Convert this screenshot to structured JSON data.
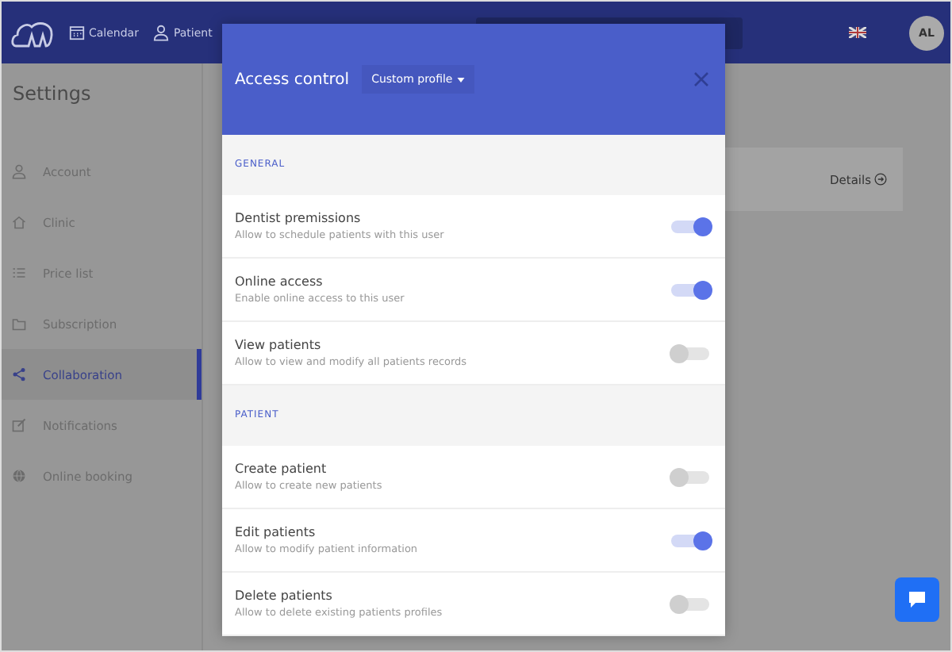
{
  "nav": {
    "items": [
      {
        "label": "Calendar",
        "kind": "calendar"
      },
      {
        "label": "Patient",
        "kind": "user"
      }
    ],
    "avatar": "AL"
  },
  "sidebar": {
    "title": "Settings",
    "items": [
      {
        "label": "Account",
        "kind": "user",
        "selected": false
      },
      {
        "label": "Clinic",
        "kind": "home",
        "selected": false
      },
      {
        "label": "Price list",
        "kind": "list",
        "selected": false
      },
      {
        "label": "Subscription",
        "kind": "folder",
        "selected": false
      },
      {
        "label": "Collaboration",
        "kind": "share",
        "selected": true
      },
      {
        "label": "Notifications",
        "kind": "edit",
        "selected": false
      },
      {
        "label": "Online booking",
        "kind": "globe",
        "selected": false
      }
    ]
  },
  "content": {
    "details_link": "Details"
  },
  "modal": {
    "title": "Access control",
    "profile": "Custom profile",
    "sections": [
      {
        "title": "GENERAL",
        "permissions": [
          {
            "name": "Dentist premissions",
            "description": "Allow to schedule patients with this user",
            "on": true
          },
          {
            "name": "Online access",
            "description": "Enable online access to this user",
            "on": true
          },
          {
            "name": "View patients",
            "description": "Allow to view and modify all patients records",
            "on": false
          }
        ]
      },
      {
        "title": "PATIENT",
        "permissions": [
          {
            "name": "Create patient",
            "description": "Allow to create new patients",
            "on": false
          },
          {
            "name": "Edit patients",
            "description": "Allow to modify patient information",
            "on": true
          },
          {
            "name": "Delete patients",
            "description": "Allow to delete existing patients profiles",
            "on": false
          }
        ]
      }
    ]
  }
}
